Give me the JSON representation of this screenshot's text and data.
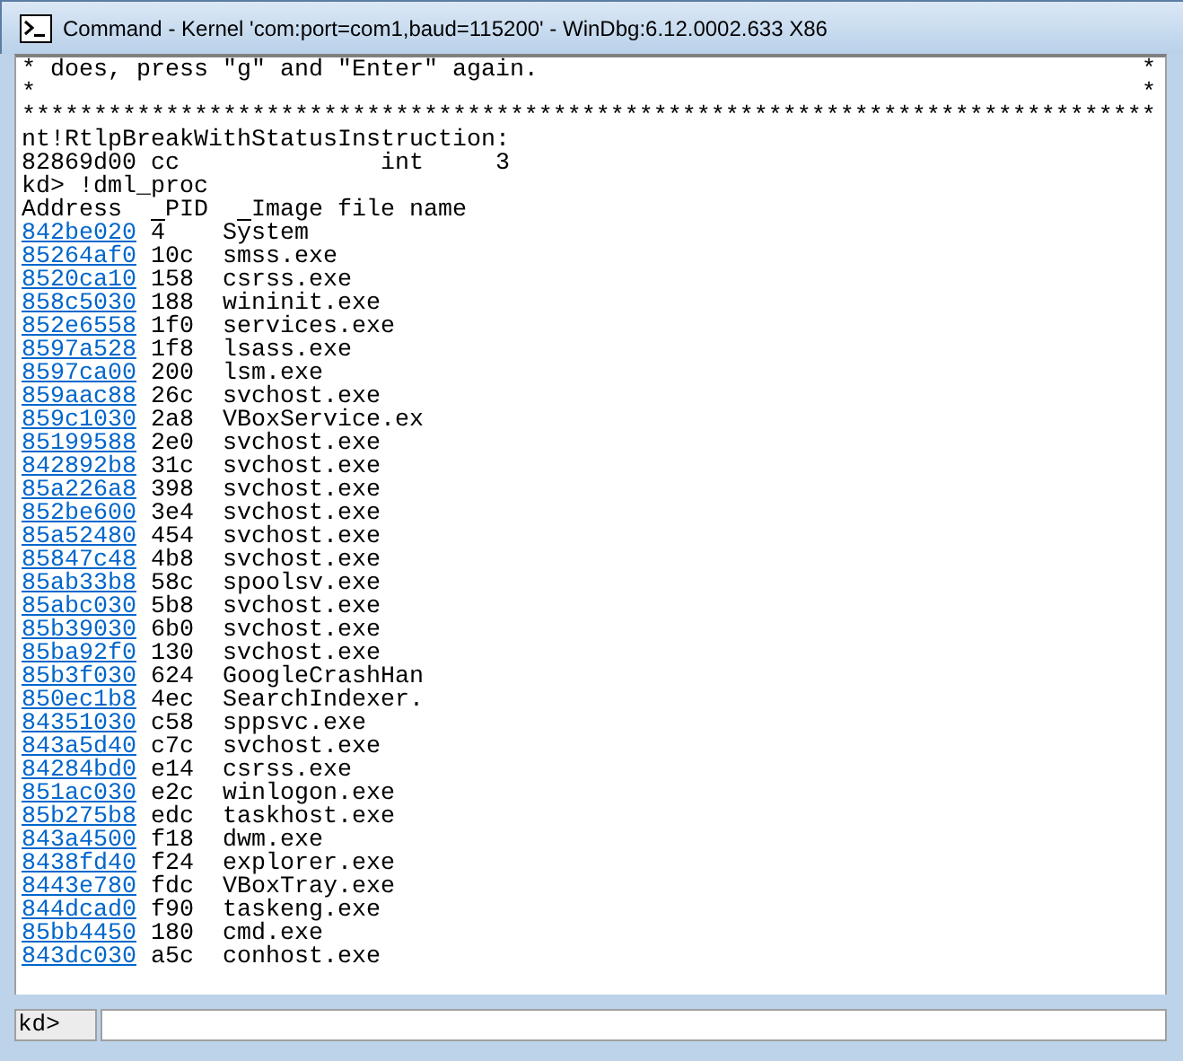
{
  "window": {
    "title": "Command - Kernel 'com:port=com1,baud=115200' - WinDbg:6.12.0002.633 X86"
  },
  "output": {
    "lines": [
      {
        "left": "* does, press \"g\" and \"Enter\" again.",
        "right": "*"
      },
      {
        "left": "*",
        "right": "*"
      },
      {
        "left": "*******************************************************************************"
      },
      {
        "left": "nt!RtlpBreakWithStatusInstruction:"
      },
      {
        "left": "82869d00 cc              int     3"
      },
      {
        "left": "kd> !dml_proc"
      }
    ],
    "table": {
      "columns": [
        "Address",
        "PID",
        "Image file name"
      ],
      "rows": [
        [
          "842be020",
          "4",
          "System"
        ],
        [
          "85264af0",
          "10c",
          "smss.exe"
        ],
        [
          "8520ca10",
          "158",
          "csrss.exe"
        ],
        [
          "858c5030",
          "188",
          "wininit.exe"
        ],
        [
          "852e6558",
          "1f0",
          "services.exe"
        ],
        [
          "8597a528",
          "1f8",
          "lsass.exe"
        ],
        [
          "8597ca00",
          "200",
          "lsm.exe"
        ],
        [
          "859aac88",
          "26c",
          "svchost.exe"
        ],
        [
          "859c1030",
          "2a8",
          "VBoxService.ex"
        ],
        [
          "85199588",
          "2e0",
          "svchost.exe"
        ],
        [
          "842892b8",
          "31c",
          "svchost.exe"
        ],
        [
          "85a226a8",
          "398",
          "svchost.exe"
        ],
        [
          "852be600",
          "3e4",
          "svchost.exe"
        ],
        [
          "85a52480",
          "454",
          "svchost.exe"
        ],
        [
          "85847c48",
          "4b8",
          "svchost.exe"
        ],
        [
          "85ab33b8",
          "58c",
          "spoolsv.exe"
        ],
        [
          "85abc030",
          "5b8",
          "svchost.exe"
        ],
        [
          "85b39030",
          "6b0",
          "svchost.exe"
        ],
        [
          "85ba92f0",
          "130",
          "svchost.exe"
        ],
        [
          "85b3f030",
          "624",
          "GoogleCrashHan"
        ],
        [
          "850ec1b8",
          "4ec",
          "SearchIndexer."
        ],
        [
          "84351030",
          "c58",
          "sppsvc.exe"
        ],
        [
          "843a5d40",
          "c7c",
          "svchost.exe"
        ],
        [
          "84284bd0",
          "e14",
          "csrss.exe"
        ],
        [
          "851ac030",
          "e2c",
          "winlogon.exe"
        ],
        [
          "85b275b8",
          "edc",
          "taskhost.exe"
        ],
        [
          "843a4500",
          "f18",
          "dwm.exe"
        ],
        [
          "8438fd40",
          "f24",
          "explorer.exe"
        ],
        [
          "8443e780",
          "fdc",
          "VBoxTray.exe"
        ],
        [
          "844dcad0",
          "f90",
          "taskeng.exe"
        ],
        [
          "85bb4450",
          "180",
          "cmd.exe"
        ],
        [
          "843dc030",
          "a5c",
          "conhost.exe"
        ]
      ]
    }
  },
  "command_bar": {
    "prompt": "kd>"
  }
}
